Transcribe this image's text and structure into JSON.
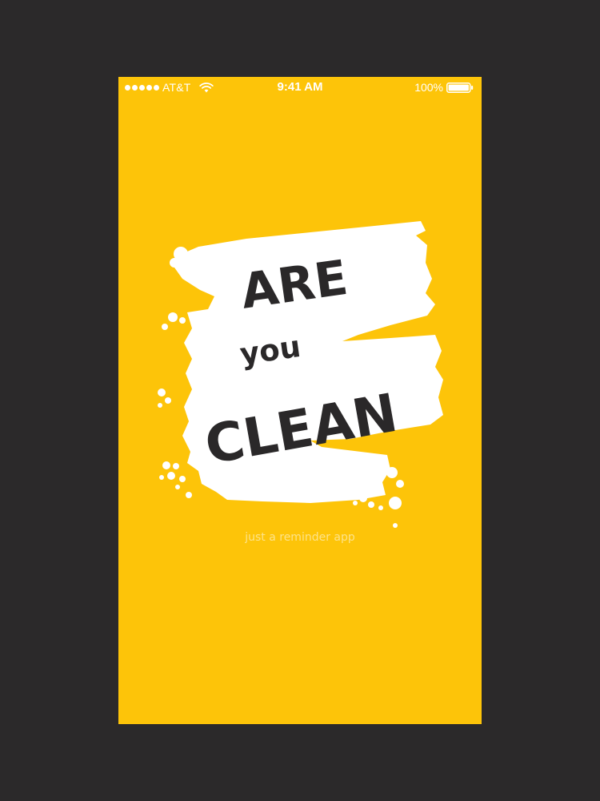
{
  "status_bar": {
    "carrier": "AT&T",
    "time": "9:41 AM",
    "battery": "100%",
    "signal_bars": 5,
    "icons": [
      "signal-dots-icon",
      "wifi-icon",
      "battery-icon"
    ]
  },
  "splash": {
    "line1": "ARE",
    "line2": "you",
    "line3": "CLEAN",
    "tagline": "just a reminder app"
  },
  "colors": {
    "background": "#2b292a",
    "screen": "#fdc409",
    "brush": "#ffffff",
    "title_text": "#2a2829",
    "tagline": "#fde38a"
  }
}
